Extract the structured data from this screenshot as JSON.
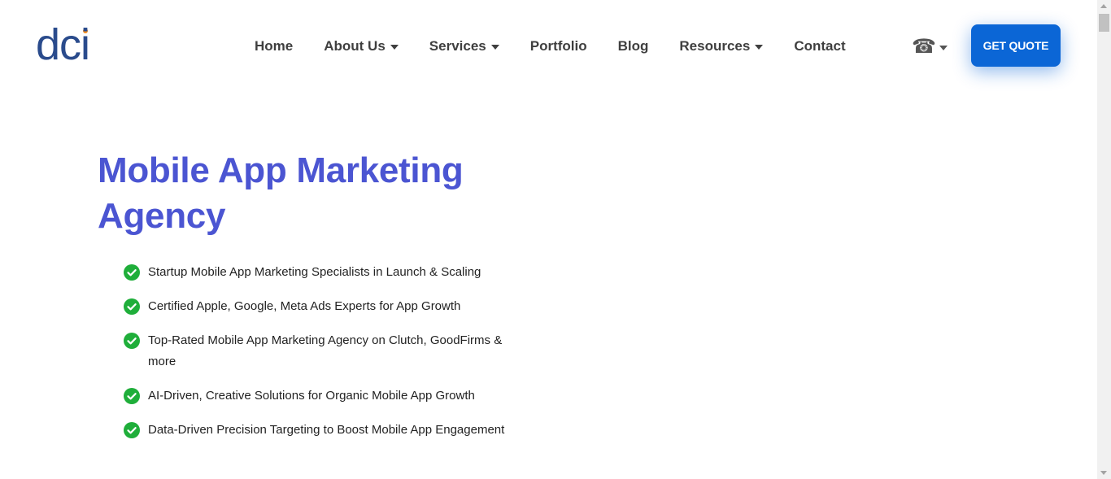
{
  "header": {
    "logo": {
      "letters_before": "dc",
      "letter_i": "i",
      "accent_color": "#f28c1f",
      "text_color": "#2a4b8c"
    },
    "nav": [
      {
        "label": "Home",
        "has_dropdown": false
      },
      {
        "label": "About Us",
        "has_dropdown": true
      },
      {
        "label": "Services",
        "has_dropdown": true
      },
      {
        "label": "Portfolio",
        "has_dropdown": false
      },
      {
        "label": "Blog",
        "has_dropdown": false
      },
      {
        "label": "Resources",
        "has_dropdown": true
      },
      {
        "label": "Contact",
        "has_dropdown": false
      }
    ],
    "phone": {
      "icon": "phone-icon",
      "glyph": "☎",
      "has_dropdown": true
    },
    "cta": {
      "label": "GET QUOTE",
      "color": "#0b66d6"
    }
  },
  "hero": {
    "title": "Mobile App Marketing Agency",
    "title_color": "#4b55d2",
    "check_color": "#1fae3a",
    "features": [
      "Startup Mobile App Marketing Specialists in Launch & Scaling",
      "Certified Apple, Google, Meta Ads Experts for App Growth",
      "Top-Rated Mobile App Marketing Agency on Clutch, GoodFirms & more",
      "AI-Driven, Creative Solutions for Organic Mobile App Growth",
      "Data-Driven Precision Targeting to Boost Mobile App Engagement"
    ]
  }
}
